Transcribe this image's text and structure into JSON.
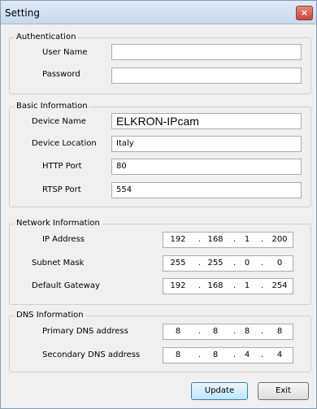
{
  "window": {
    "title": "Setting",
    "close_glyph": "×"
  },
  "authentication": {
    "legend": "Authentication",
    "user_name_label": "User Name",
    "user_name_value": "",
    "password_label": "Password",
    "password_value": ""
  },
  "basic": {
    "legend": "Basic Information",
    "device_name_label": "Device Name",
    "device_name_value": "ELKRON-IPcam",
    "device_location_label": "Device Location",
    "device_location_value": "Italy",
    "http_port_label": "HTTP Port",
    "http_port_value": "80",
    "rtsp_port_label": "RTSP Port",
    "rtsp_port_value": "554"
  },
  "network": {
    "legend": "Network Information",
    "ip_label": "IP Address",
    "ip": [
      "192",
      "168",
      "1",
      "200"
    ],
    "mask_label": "Subnet Mask",
    "mask": [
      "255",
      "255",
      "0",
      "0"
    ],
    "gateway_label": "Default Gateway",
    "gateway": [
      "192",
      "168",
      "1",
      "254"
    ]
  },
  "dns": {
    "legend": "DNS Information",
    "primary_label": "Primary DNS address",
    "primary": [
      "8",
      "8",
      "8",
      "8"
    ],
    "secondary_label": "Secondary DNS address",
    "secondary": [
      "8",
      "8",
      "4",
      "4"
    ]
  },
  "buttons": {
    "update": "Update",
    "exit": "Exit"
  },
  "ip_dot": "."
}
